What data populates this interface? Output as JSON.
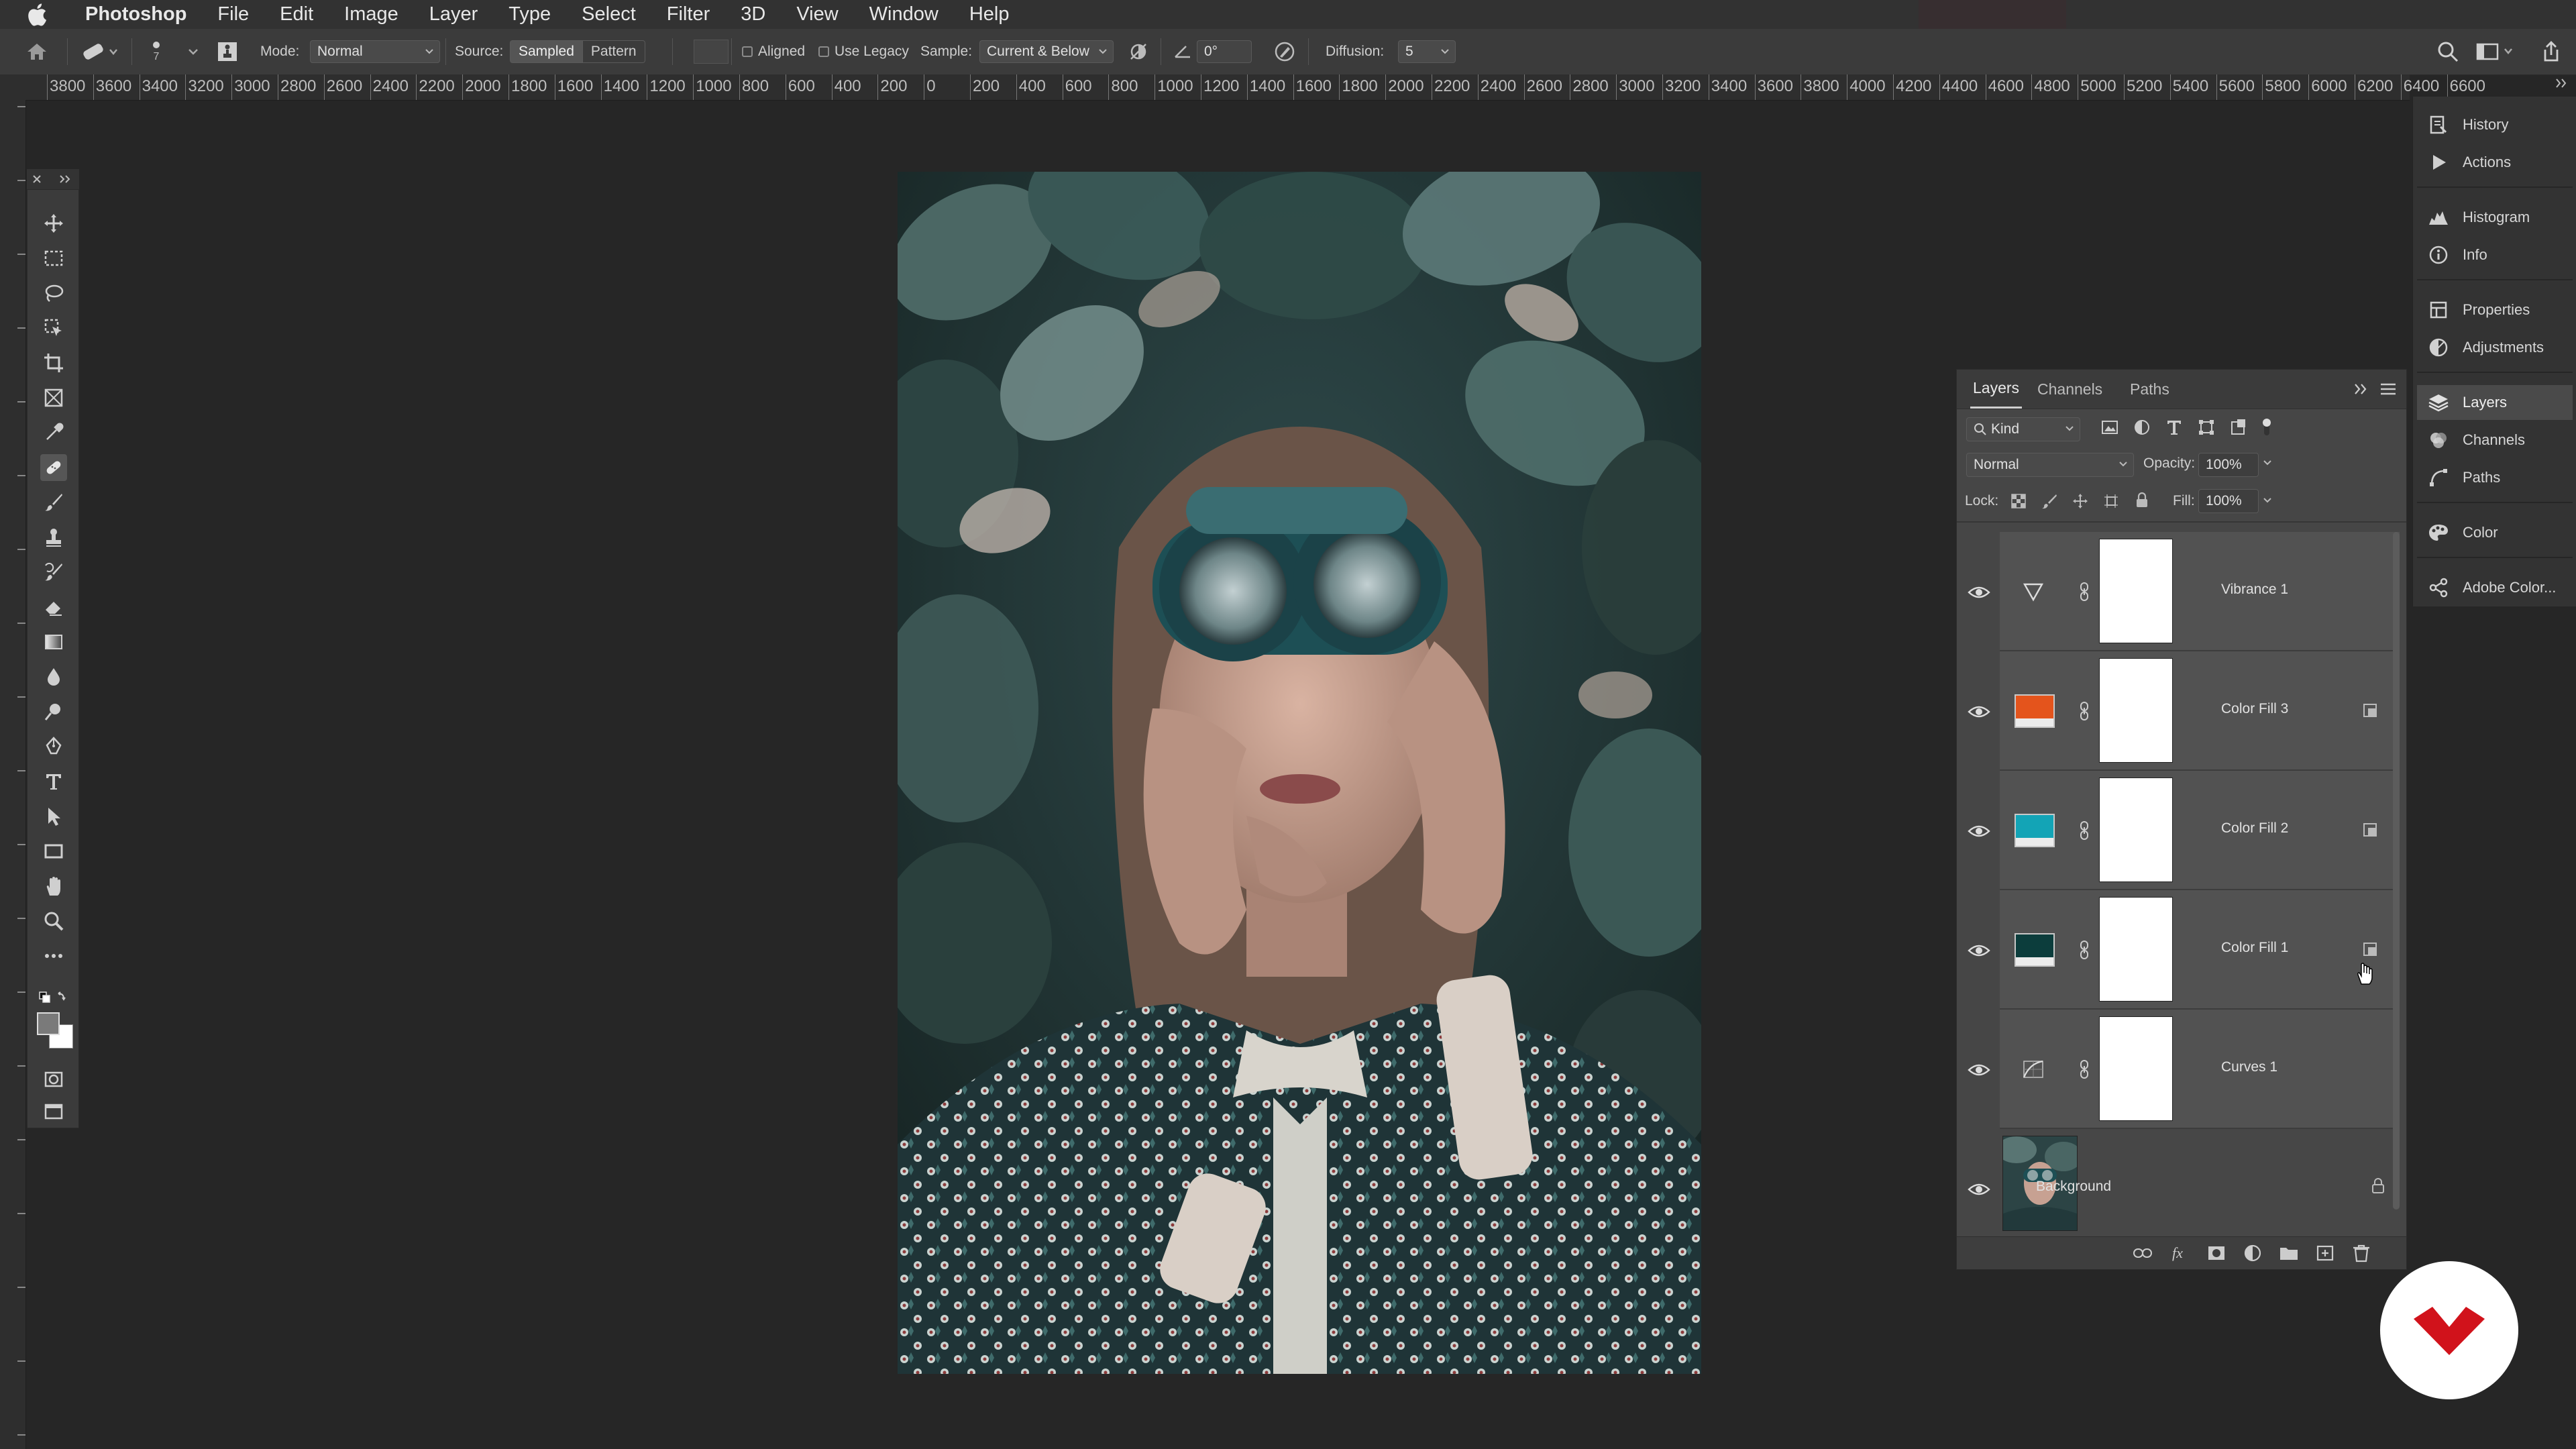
{
  "menubar": {
    "app_name": "Photoshop",
    "items": [
      "File",
      "Edit",
      "Image",
      "Layer",
      "Type",
      "Select",
      "Filter",
      "3D",
      "View",
      "Window",
      "Help"
    ]
  },
  "options": {
    "brush_size": "7",
    "mode_label": "Mode:",
    "mode_value": "Normal",
    "source_label": "Source:",
    "source_sampled": "Sampled",
    "source_pattern": "Pattern",
    "aligned_label": "Aligned",
    "use_legacy_label": "Use Legacy",
    "sample_label": "Sample:",
    "sample_value": "Current & Below",
    "angle_value": "0°",
    "diffusion_label": "Diffusion:",
    "diffusion_value": "5"
  },
  "ruler": {
    "labels": [
      "3800",
      "3600",
      "3400",
      "3200",
      "3000",
      "2800",
      "2600",
      "2400",
      "2200",
      "2000",
      "1800",
      "1600",
      "1400",
      "1200",
      "1000",
      "800",
      "600",
      "400",
      "200",
      "0",
      "200",
      "400",
      "600",
      "800",
      "1000",
      "1200",
      "1400",
      "1600",
      "1800",
      "2000",
      "2200",
      "2400",
      "2600",
      "2800",
      "3000",
      "3200",
      "3400",
      "3600",
      "3800",
      "4000",
      "4200",
      "4400",
      "4600",
      "4800",
      "5000",
      "5200",
      "5400",
      "5600",
      "5800",
      "6000",
      "6200",
      "6400",
      "6600"
    ]
  },
  "layers_panel": {
    "tabs": [
      "Layers",
      "Channels",
      "Paths"
    ],
    "filter_kind": "Kind",
    "blend_mode": "Normal",
    "opacity_label": "Opacity:",
    "opacity_value": "100%",
    "lock_label": "Lock:",
    "fill_label": "Fill:",
    "fill_value": "100%",
    "layers": [
      {
        "name": "Vibrance 1",
        "type": "vibrance"
      },
      {
        "name": "Color Fill 3",
        "type": "fill",
        "color": "#e4541c"
      },
      {
        "name": "Color Fill 2",
        "type": "fill",
        "color": "#13a4b6"
      },
      {
        "name": "Color Fill 1",
        "type": "fill",
        "color": "#0c3d3c"
      },
      {
        "name": "Curves 1",
        "type": "curves"
      },
      {
        "name": "Background",
        "type": "background"
      }
    ]
  },
  "dock": {
    "items": [
      "History",
      "Actions",
      "Histogram",
      "Info",
      "Properties",
      "Adjustments",
      "Layers",
      "Channels",
      "Paths",
      "Color",
      "Adobe Color..."
    ]
  },
  "colors": {
    "app_bg": "#262626",
    "panel_bg": "#464646",
    "accent_red": "#d1121b"
  }
}
